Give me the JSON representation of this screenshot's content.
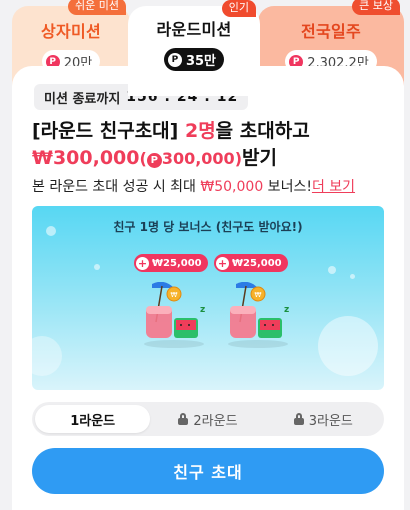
{
  "tabs": [
    {
      "badge": "쉬운 미션",
      "title": "상자미션",
      "reward": "20만",
      "coin": "P"
    },
    {
      "badge": "인기",
      "title": "라운드미션",
      "reward": "35만",
      "coin": "P"
    },
    {
      "badge": "큰 보상",
      "title": "전국일주",
      "reward": "2,302.2만",
      "coin": "P"
    }
  ],
  "timer": {
    "label": "미션 종료까지",
    "value": "156 : 24 : 12"
  },
  "headline": {
    "part1": "[라운드 친구초대] ",
    "count": "2명",
    "part2": "을 초대하고",
    "amount": "₩300,000",
    "paren_open": "(",
    "coin": "P",
    "point_amount": "300,000",
    "paren_close": ")",
    "suffix": "받기"
  },
  "sub": {
    "text": "본 라운드 초대 성공 시 최대 ",
    "amount": "₩50,000",
    "text2": " 보너스!",
    "link": "더 보기"
  },
  "banner": {
    "title": "친구 1명 당 보너스 (친구도 받아요!)",
    "chips": [
      "₩25,000",
      "₩25,000"
    ],
    "colors": {
      "top": "#57d7f3",
      "bottom": "#d9f4fb"
    }
  },
  "rounds": [
    {
      "label": "1라운드",
      "locked": false,
      "active": true
    },
    {
      "label": "2라운드",
      "locked": true,
      "active": false
    },
    {
      "label": "3라운드",
      "locked": true,
      "active": false
    }
  ],
  "cta": {
    "label": "친구 초대",
    "color": "#2f9bf3"
  },
  "accent": "#ef3d5a"
}
